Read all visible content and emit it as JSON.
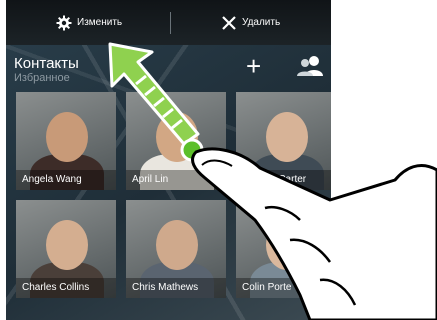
{
  "drop_bar": {
    "edit_label": "Изменить",
    "delete_label": "Удалить"
  },
  "header": {
    "title": "Контакты",
    "subtitle": "Избранное"
  },
  "favorites": [
    {
      "name": "Angela Wang"
    },
    {
      "name": "April Lin"
    },
    {
      "name": "o Carter"
    },
    {
      "name": "Charles Collins"
    },
    {
      "name": "Chris Mathews"
    },
    {
      "name": "Colin Porte"
    }
  ],
  "colors": {
    "gesture_arrow": "#8fd14f",
    "drop_bar": "#161c20",
    "tile_label_bg": "rgba(0,0,0,0.35)"
  },
  "icons": {
    "edit": "gear-icon",
    "delete": "close-icon",
    "add": "plus-icon",
    "people": "people-icon",
    "gesture": "hand-pointer-icon"
  }
}
